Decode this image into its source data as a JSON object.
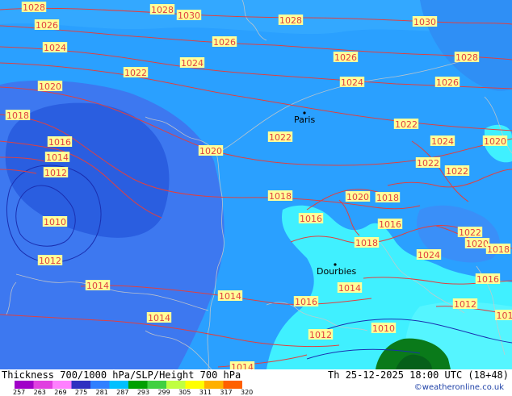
{
  "map": {
    "isobars": [
      {
        "text": "1028"
      },
      {
        "text": "1028"
      },
      {
        "text": "1030"
      },
      {
        "text": "1028"
      },
      {
        "text": "1030"
      },
      {
        "text": "1026"
      },
      {
        "text": "1026"
      },
      {
        "text": "1024"
      },
      {
        "text": "1024"
      },
      {
        "text": "1026"
      },
      {
        "text": "1028"
      },
      {
        "text": "1022"
      },
      {
        "text": "1020"
      },
      {
        "text": "1024"
      },
      {
        "text": "1026"
      },
      {
        "text": "1018"
      },
      {
        "text": "1022"
      },
      {
        "text": "1022"
      },
      {
        "text": "1016"
      },
      {
        "text": "1024"
      },
      {
        "text": "1020"
      },
      {
        "text": "1014"
      },
      {
        "text": "1020"
      },
      {
        "text": "1022"
      },
      {
        "text": "1012"
      },
      {
        "text": "1022"
      },
      {
        "text": "1018"
      },
      {
        "text": "1020"
      },
      {
        "text": "1018"
      },
      {
        "text": "1016"
      },
      {
        "text": "1010"
      },
      {
        "text": "1016"
      },
      {
        "text": "1022"
      },
      {
        "text": "1020"
      },
      {
        "text": "1018"
      },
      {
        "text": "1012"
      },
      {
        "text": "1018"
      },
      {
        "text": "1024"
      },
      {
        "text": "1014"
      },
      {
        "text": "1014"
      },
      {
        "text": "1014"
      },
      {
        "text": "1016"
      },
      {
        "text": "1014"
      },
      {
        "text": "1012"
      },
      {
        "text": "1010"
      },
      {
        "text": "1012"
      },
      {
        "text": "1014"
      },
      {
        "text": "101"
      },
      {
        "text": "1016"
      }
    ],
    "cities": [
      {
        "name": "Paris"
      },
      {
        "name": "Dourbies"
      }
    ]
  },
  "footer": {
    "title": "Thickness 700/1000 hPa/SLP/Height 700 hPa",
    "datetime": "Th 25-12-2025 18:00 UTC (18+48)",
    "credit": "©weatheronline.co.uk",
    "colorbar_ticks": [
      "257",
      "263",
      "269",
      "275",
      "281",
      "287",
      "293",
      "299",
      "305",
      "311",
      "317",
      "320"
    ],
    "colorbar_colors": [
      "#a000c8",
      "#e040e0",
      "#ff80ff",
      "#3030c0",
      "#3080ff",
      "#00c0ff",
      "#00a000",
      "#40d040",
      "#c0ff40",
      "#ffff00",
      "#ffb000",
      "#ff6000"
    ]
  },
  "colors": {
    "sea_blue": "#2aa0ff",
    "low_blue": "#3d78f0",
    "core_blue": "#2a5ee0",
    "cyan": "#40f0ff",
    "green": "#0a7a1a",
    "isobar": "#e04040",
    "label_bg": "#ffff99"
  }
}
